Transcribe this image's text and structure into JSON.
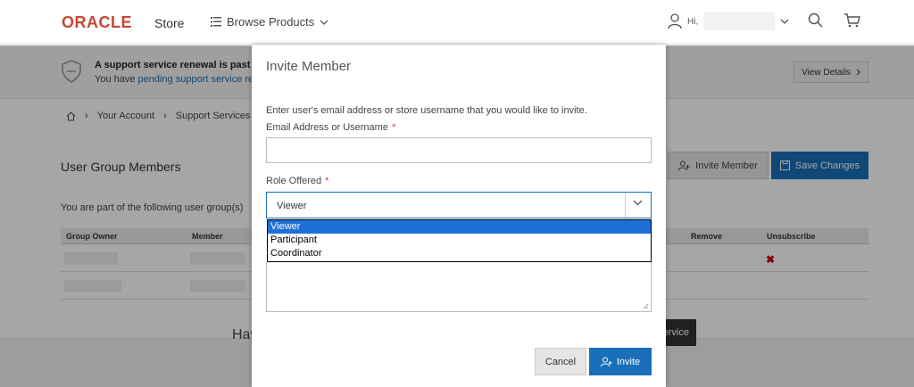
{
  "header": {
    "logo": "ORACLE",
    "store": "Store",
    "browse_label": "Browse Products",
    "user_hi": "Hi,"
  },
  "alert": {
    "title": "A support service renewal is past d",
    "text_prefix": "You have ",
    "link": "pending support service rer",
    "view_details": "View Details"
  },
  "breadcrumb": [
    "Your Account",
    "Support Services Dasl"
  ],
  "section": {
    "title": "User Group Members",
    "part_of": "You are part of the following user group(s)",
    "invite_member": "Invite Member",
    "save_changes": "Save Changes"
  },
  "table": {
    "headers": [
      "Group Owner",
      "Member",
      "Remove",
      "Unsubscribe"
    ]
  },
  "footer": {
    "text": "Hav",
    "button": "ervice"
  },
  "modal": {
    "title": "Invite Member",
    "description": "Enter user's email address or store username that you would like to invite.",
    "email_label": "Email Address or Username",
    "email_value": "",
    "required_mark": "*",
    "role_label": "Role Offered",
    "role_selected": "Viewer",
    "role_options": [
      "Viewer",
      "Participant",
      "Coordinator"
    ],
    "cancel": "Cancel",
    "invite": "Invite"
  },
  "colors": {
    "brand_red": "#c74634",
    "primary_blue": "#1a6fb8",
    "selected_option": "#1e70d6"
  }
}
